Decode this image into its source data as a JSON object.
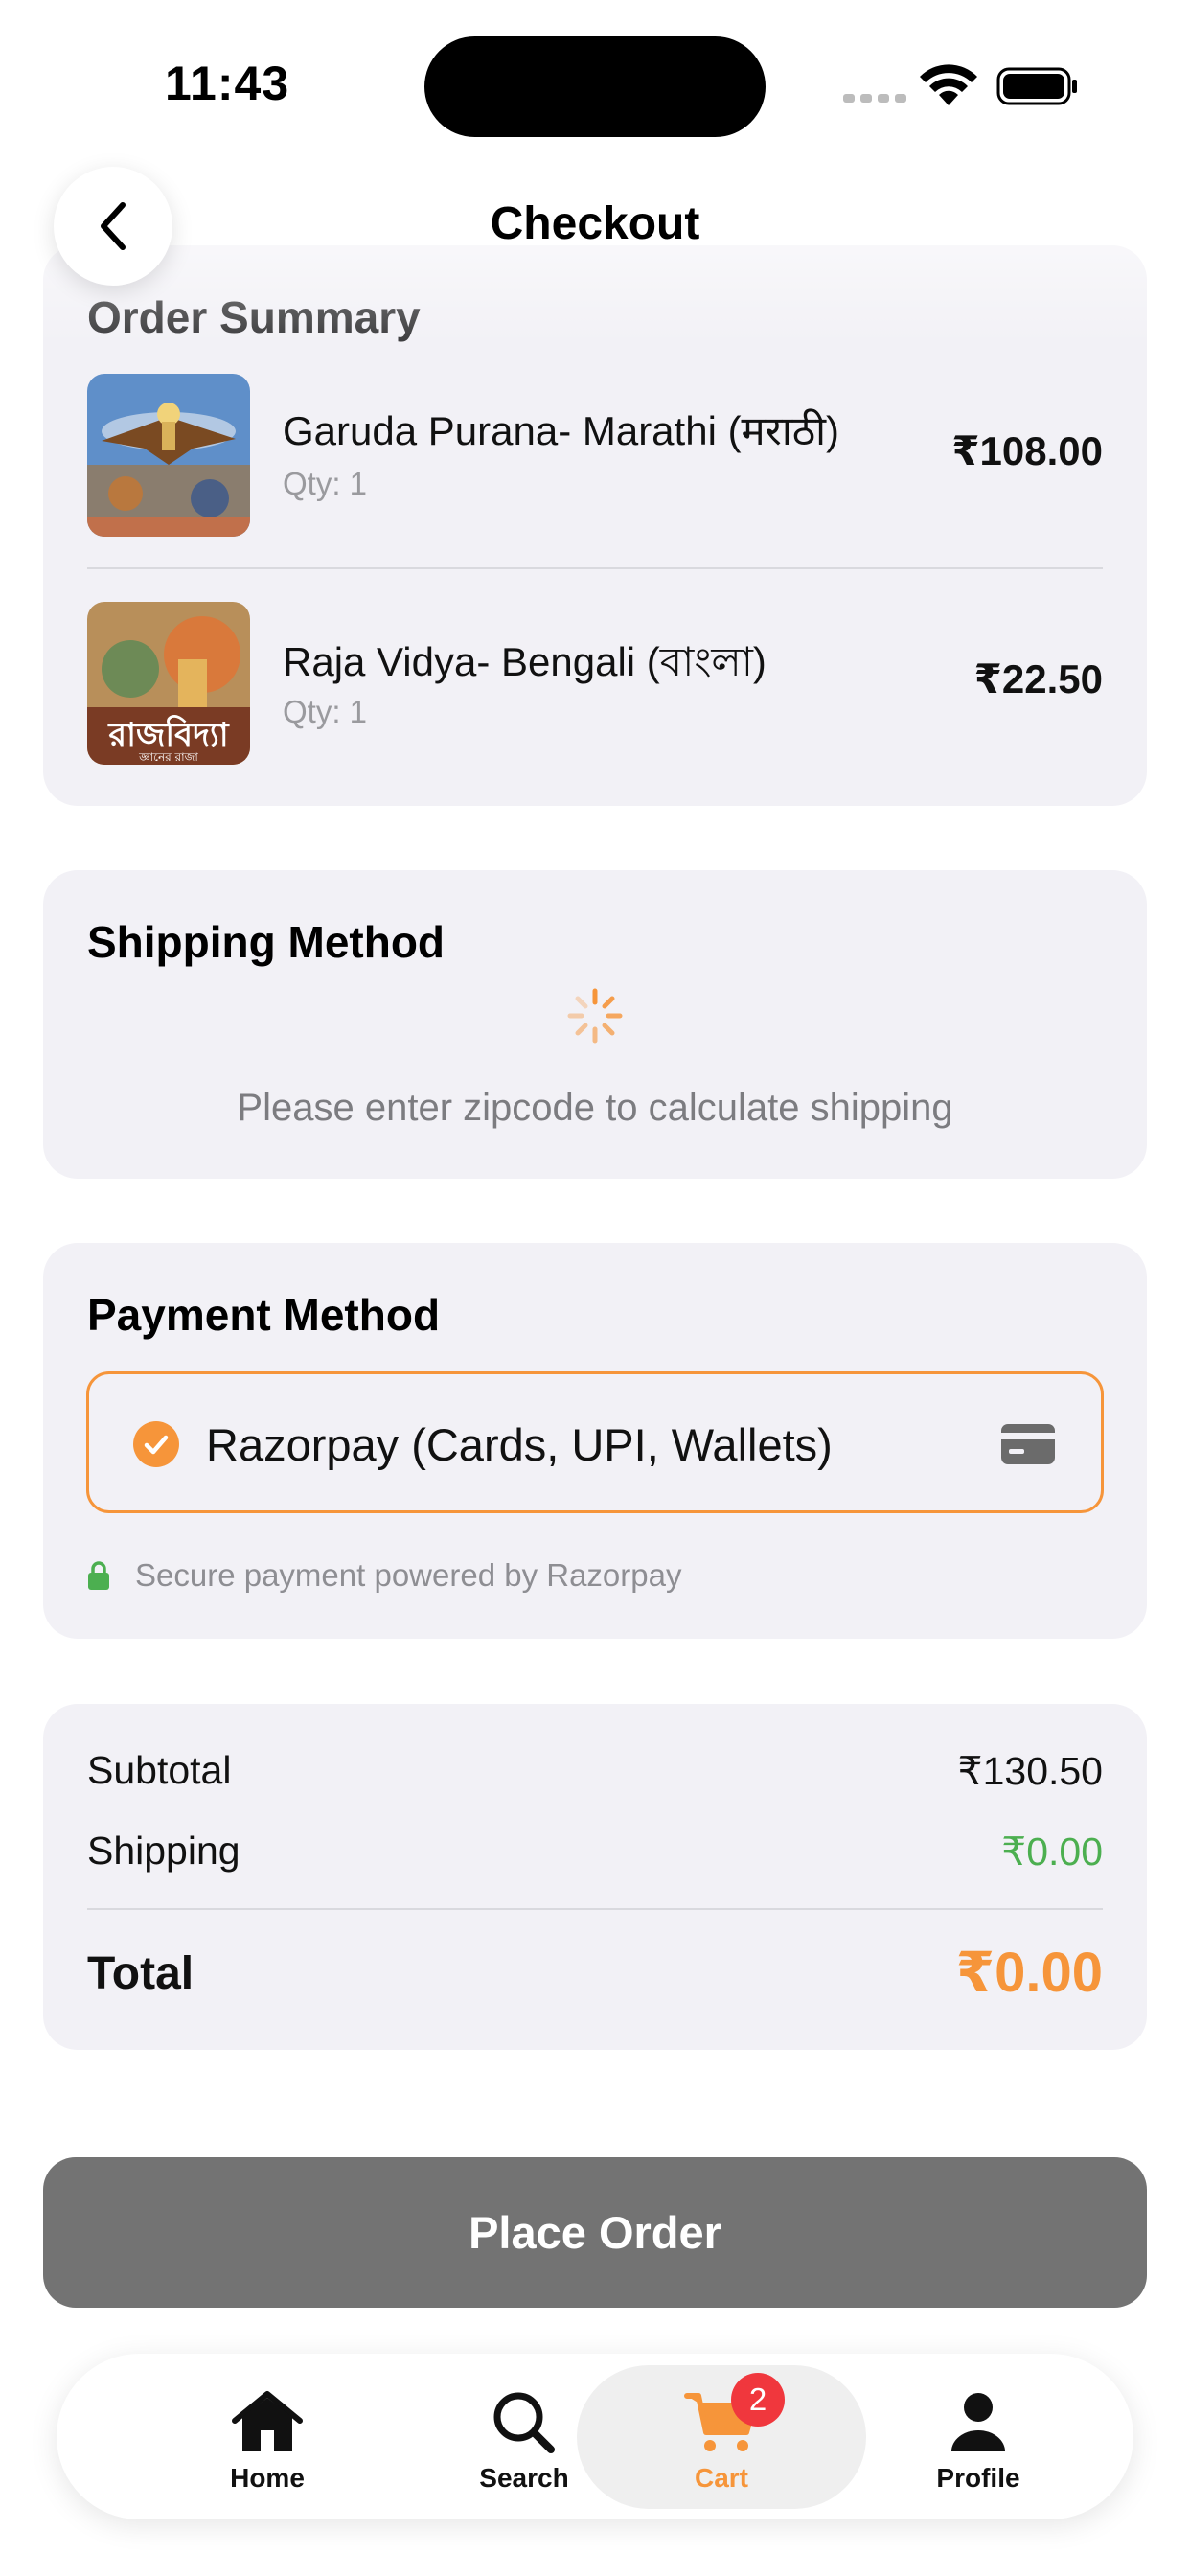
{
  "status_bar": {
    "time": "11:43"
  },
  "header": {
    "title": "Checkout"
  },
  "order_summary": {
    "title": "Order Summary",
    "items": [
      {
        "name": "Garuda Purana- Marathi (मराठी)",
        "qty": "Qty: 1",
        "price": "₹108.00"
      },
      {
        "name": "Raja Vidya- Bengali (বাংলা)",
        "qty": "Qty: 1",
        "price": "₹22.50",
        "cover_text": "রাজবিদ্যা",
        "cover_subtext": "জ্ঞানের রাজা"
      }
    ]
  },
  "shipping": {
    "title": "Shipping Method",
    "message": "Please enter zipcode to calculate shipping"
  },
  "payment": {
    "title": "Payment Method",
    "option_label": "Razorpay (Cards, UPI, Wallets)",
    "secure_text": "Secure payment powered by Razorpay"
  },
  "totals": {
    "subtotal_label": "Subtotal",
    "subtotal_value": "₹130.50",
    "shipping_label": "Shipping",
    "shipping_value": "₹0.00",
    "total_label": "Total",
    "total_value": "₹0.00"
  },
  "place_order": {
    "label": "Place Order"
  },
  "tab_bar": {
    "tabs": [
      {
        "label": "Home",
        "icon": "home-icon"
      },
      {
        "label": "Search",
        "icon": "search-icon"
      },
      {
        "label": "Cart",
        "icon": "cart-icon",
        "badge": "2",
        "active": true
      },
      {
        "label": "Profile",
        "icon": "person-icon"
      }
    ]
  },
  "colors": {
    "accent": "#f6953a",
    "card_bg": "#f2f1f6",
    "success": "#4caf50",
    "button_disabled": "#737373",
    "badge": "#f0373d"
  }
}
